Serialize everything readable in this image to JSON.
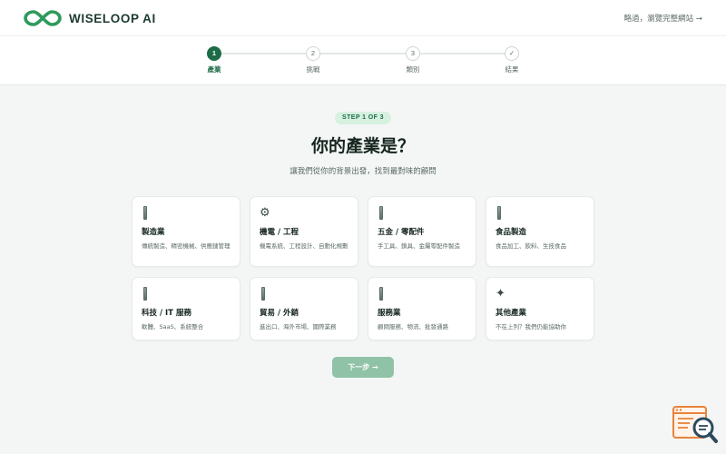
{
  "brand": {
    "name": "WISELOOP AI",
    "logo_color": "#2e9a5c"
  },
  "header": {
    "skip_label": "略過，瀏覽完整網站 →"
  },
  "stepper": {
    "steps": [
      {
        "number": "1",
        "label": "產業",
        "state": "active"
      },
      {
        "number": "2",
        "label": "挑戰",
        "state": "pending"
      },
      {
        "number": "3",
        "label": "類別",
        "state": "pending"
      },
      {
        "number": "✓",
        "label": "結果",
        "state": "pending"
      }
    ]
  },
  "main": {
    "badge": "STEP 1 OF 3",
    "title": "你的產業是？",
    "subtitle": "讓我們從你的背景出發，找到最對味的顧問"
  },
  "industries": [
    {
      "icon": "building-icon",
      "title": "製造業",
      "desc": "傳統製造、精密機械、供應鏈管理"
    },
    {
      "icon": "gear-icon",
      "glyph": "⚙",
      "title": "機電 / 工程",
      "desc": "機電系統、工程設計、自動化規劃"
    },
    {
      "icon": "bolt-icon",
      "title": "五金 / 零配件",
      "desc": "手工具、鎖具、金屬零配件製造"
    },
    {
      "icon": "food-icon",
      "title": "食品製造",
      "desc": "食品加工、飲料、生技食品"
    },
    {
      "icon": "laptop-icon",
      "title": "科技 / IT 服務",
      "desc": "軟體、SaaS、系統整合"
    },
    {
      "icon": "ship-icon",
      "title": "貿易 / 外銷",
      "desc": "進出口、海外市場、國際業務"
    },
    {
      "icon": "handshake-icon",
      "title": "服務業",
      "desc": "顧問服務、物流、批發通路"
    },
    {
      "icon": "sparkle-icon",
      "glyph": "✦",
      "title": "其他產業",
      "desc": "不在上列？我們仍能協助你"
    }
  ],
  "actions": {
    "next_label": "下一步 →",
    "next_color": "#8fc2a6"
  },
  "colors": {
    "accent": "#1e6b47",
    "badge_bg": "#d6f1e0"
  }
}
